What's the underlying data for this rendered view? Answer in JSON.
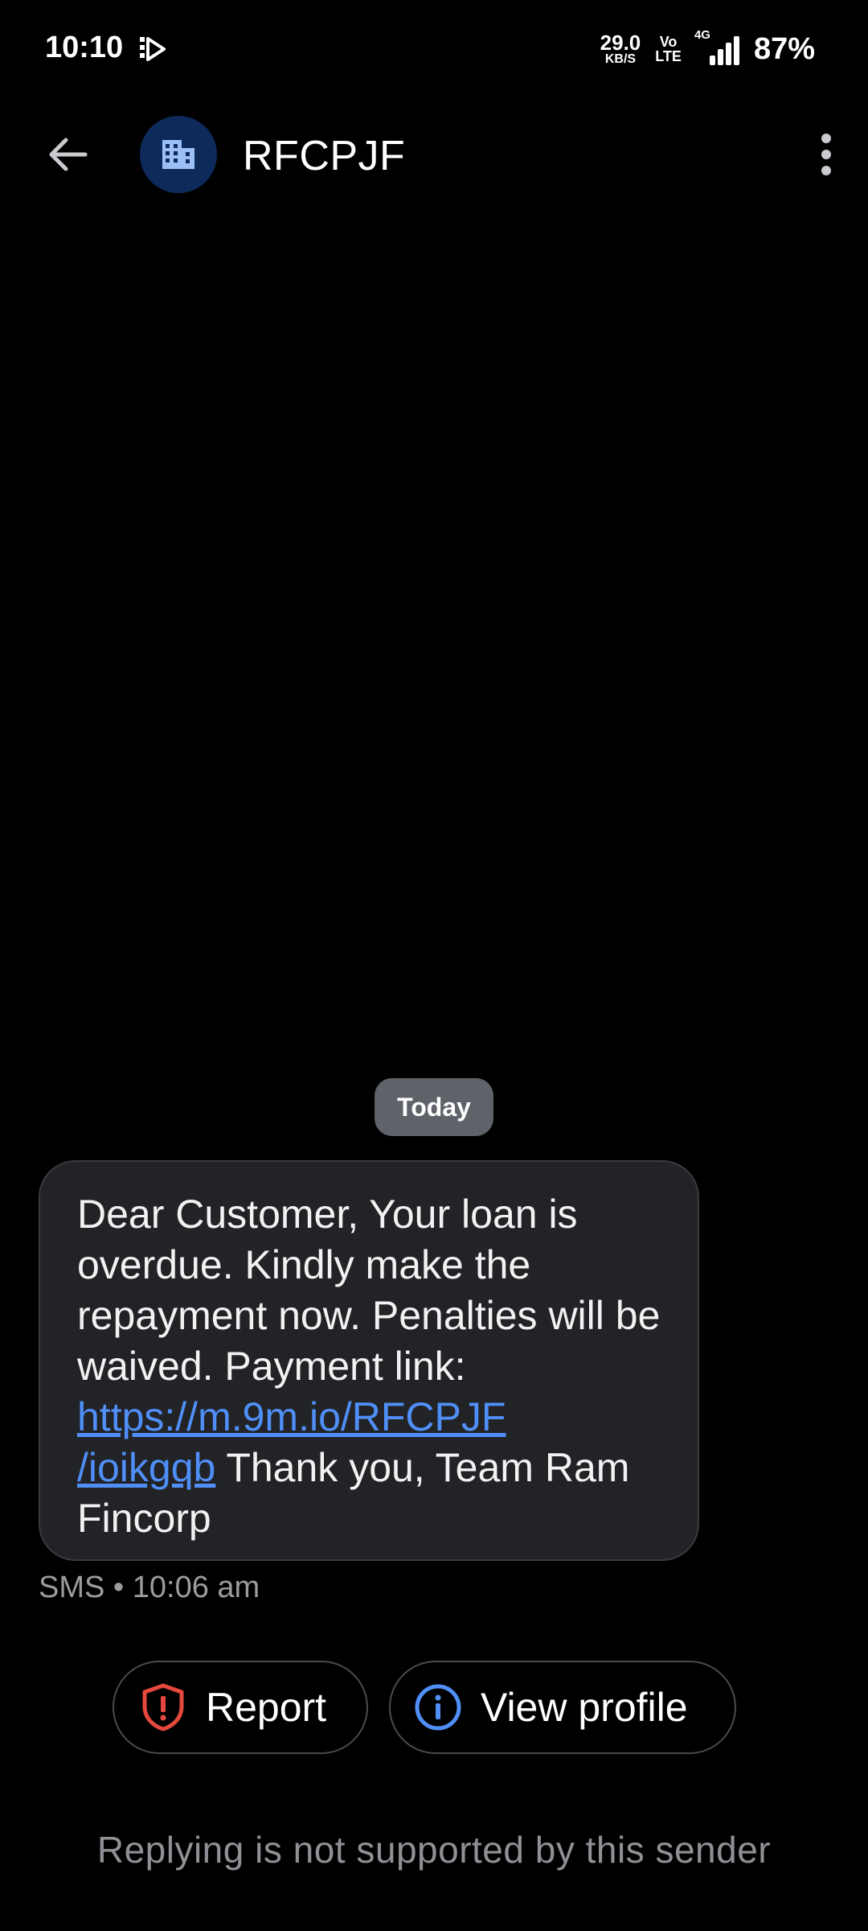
{
  "status_bar": {
    "time": "10:10",
    "net_speed_value": "29.0",
    "net_speed_unit": "KB/S",
    "volte_top": "Vo",
    "volte_bottom": "LTE",
    "network_type": "4G",
    "battery": "87%"
  },
  "header": {
    "sender": "RFCPJF",
    "back_icon": "arrow-left-icon",
    "avatar_icon": "building-icon",
    "menu_icon": "more-vertical-icon"
  },
  "conversation": {
    "date_label": "Today",
    "message": {
      "text_before_link": "Dear Customer, Your loan is overdue. Kindly make the repayment now. Penalties will be waived. Payment link: ",
      "link_line1": "https://m.9m.io/RFCPJF",
      "link_line2": "/ioikgqb",
      "text_after_link": " Thank you, Team Ram Fincorp",
      "meta": "SMS • 10:06 am"
    }
  },
  "actions": {
    "report_label": "Report",
    "view_profile_label": "View profile",
    "report_color": "#e5483d",
    "info_color": "#4f8ff7"
  },
  "footer": {
    "reply_note": "Replying is not supported by this sender"
  }
}
